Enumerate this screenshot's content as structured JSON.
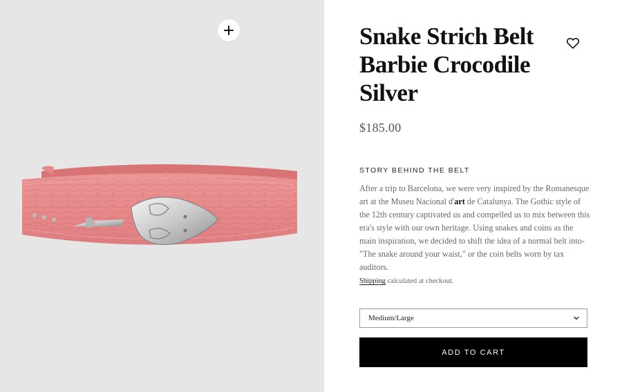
{
  "product": {
    "title": "Snake Strich Belt Barbie Crocodile Silver",
    "price": "$185.00"
  },
  "story": {
    "heading": "STORY BEHIND THE BELT",
    "text_before": "After a trip to Barcelona, we were very inspired by the Romanesque art at the Museu Nacional d'",
    "text_strong": "art",
    "text_after": " de Catalunya. The Gothic style of the 12th century captivated us and compelled us to mix between this era's style with our own heritage. Using snakes and coins as the main inspiration, we decided to shift the idea of a normal belt into- \"The snake around your waist,\" or the coin belts worn by tax auditors."
  },
  "shipping": {
    "link_label": "Shipping",
    "suffix": " calculated at checkout."
  },
  "size_select": {
    "selected": "Medium/Large"
  },
  "cart": {
    "add_label": "ADD TO CART"
  },
  "icons": {
    "zoom": "plus-icon",
    "wishlist": "heart-icon",
    "dropdown": "chevron-down-icon"
  },
  "colors": {
    "button_bg": "#000000",
    "gallery_bg": "#e6e6e6",
    "belt_pink": "#e8898b"
  }
}
